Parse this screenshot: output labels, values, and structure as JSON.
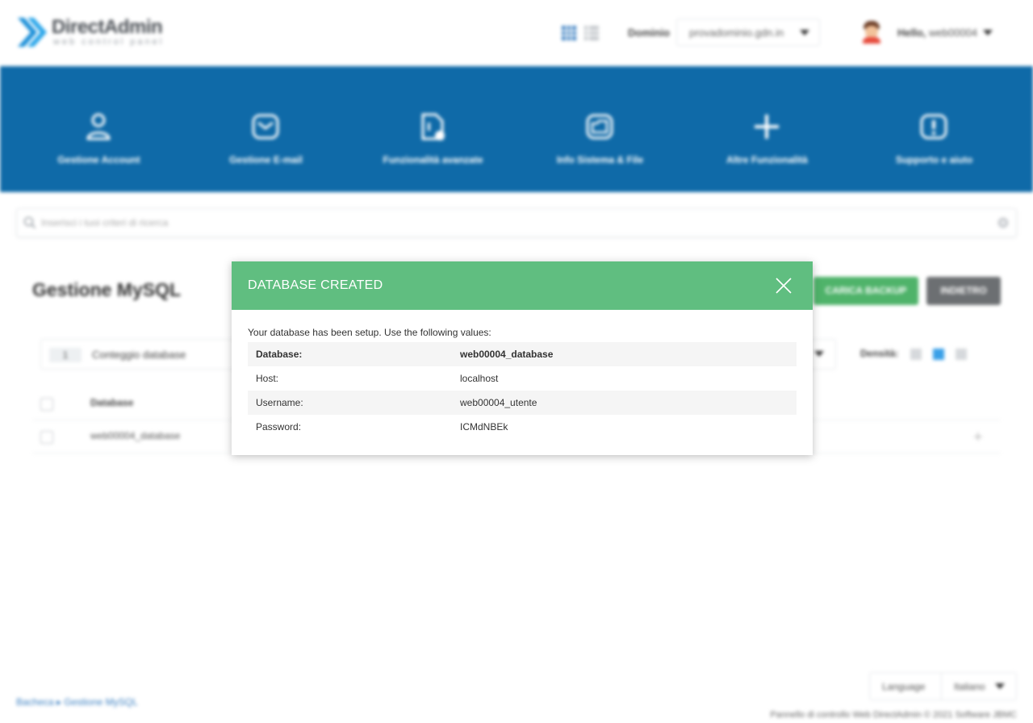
{
  "header": {
    "logo_text": "DirectAdmin",
    "logo_sub": "web control panel",
    "domain_label": "Dominio",
    "domain_value": "provadominio.gdn.in",
    "hello_prefix": "Hello,",
    "user": "web00004"
  },
  "nav": {
    "items": [
      {
        "label": "Gestione Account",
        "icon": "user-icon"
      },
      {
        "label": "Gestione E-mail",
        "icon": "mail-icon"
      },
      {
        "label": "Funzionalità avanzate",
        "icon": "advanced-file-icon"
      },
      {
        "label": "Info Sistema & File",
        "icon": "folder-icon"
      },
      {
        "label": "Altre Funzionalità",
        "icon": "plus-icon"
      },
      {
        "label": "Supporto e aiuto",
        "icon": "alert-icon"
      }
    ]
  },
  "search": {
    "placeholder": "Inserisci i tuoi criteri di ricerca"
  },
  "page": {
    "title": "Gestione MySQL",
    "upload_backup": "CARICA BACKUP",
    "back": "INDIETRO",
    "db_count": "1",
    "db_count_label": "Conteggio database",
    "density_label": "Densità:",
    "column_database": "Database",
    "row_database": "web00004_database"
  },
  "footer": {
    "breadcrumb_home": "Bacheca",
    "breadcrumb_current": "Gestione MySQL",
    "language_label": "Language",
    "language_value": "Italiano",
    "copyright": "Pannello di controllo Web DirectAdmin © 2021 Software JBMC"
  },
  "modal": {
    "title": "DATABASE CREATED",
    "intro": "Your database has been setup. Use the following values:",
    "rows": [
      {
        "key": "Database:",
        "value": "web00004_database"
      },
      {
        "key": "Host:",
        "value": "localhost"
      },
      {
        "key": "Username:",
        "value": "web00004_utente"
      },
      {
        "key": "Password:",
        "value": "ICMdNBEk"
      }
    ]
  },
  "colors": {
    "nav_blue": "#0f6aa8",
    "modal_green": "#60be80",
    "button_green": "#4fb36a",
    "button_grey": "#6c6f72"
  }
}
